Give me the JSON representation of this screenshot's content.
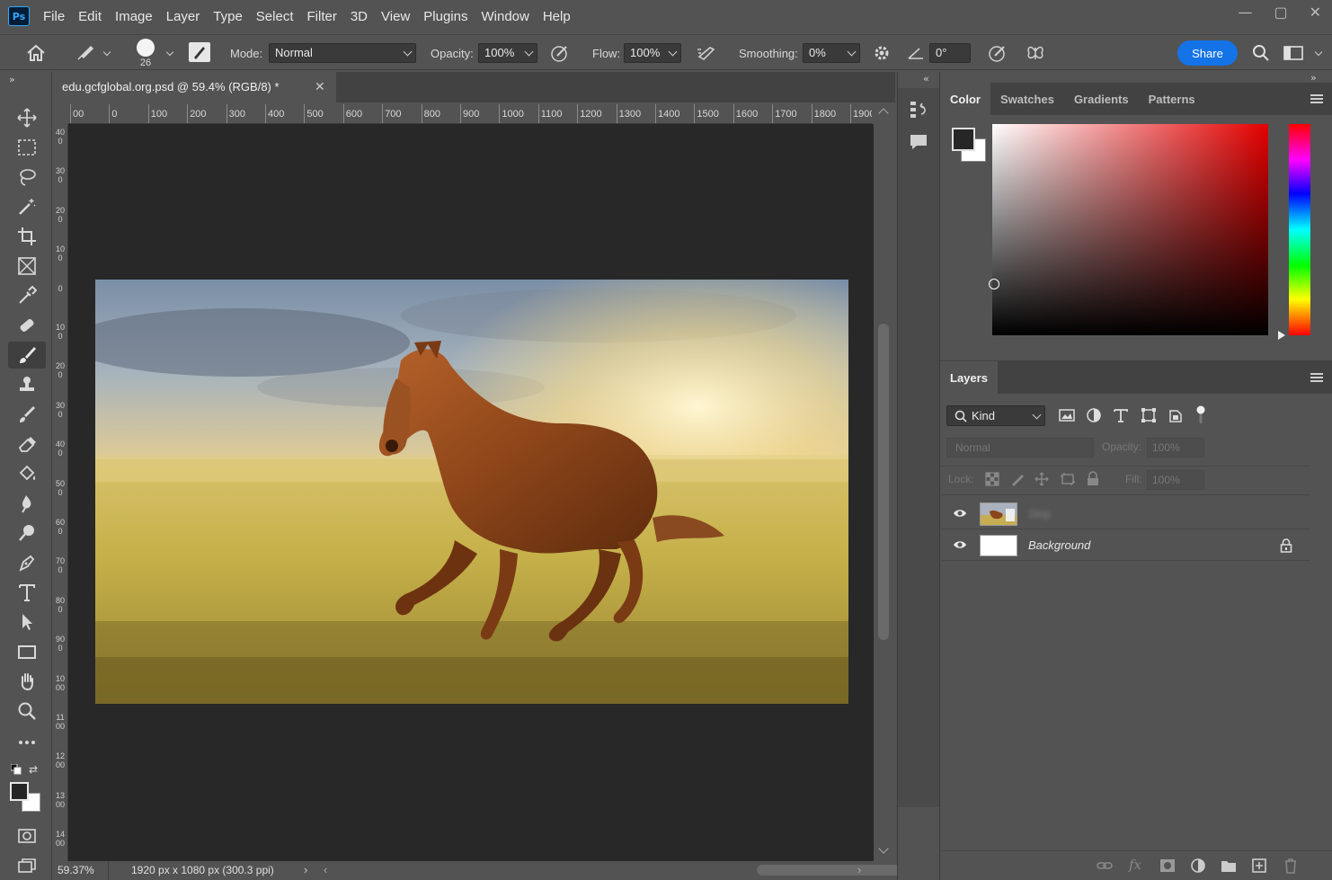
{
  "app": {
    "logo": "Ps"
  },
  "menu": [
    "File",
    "Edit",
    "Image",
    "Layer",
    "Type",
    "Select",
    "Filter",
    "3D",
    "View",
    "Plugins",
    "Window",
    "Help"
  ],
  "window_controls": {
    "minimize": "—",
    "maximize": "▢",
    "close": "✕"
  },
  "options": {
    "brush_size": "26",
    "mode_label": "Mode:",
    "mode_value": "Normal",
    "opacity_label": "Opacity:",
    "opacity_value": "100%",
    "flow_label": "Flow:",
    "flow_value": "100%",
    "smoothing_label": "Smoothing:",
    "smoothing_value": "0%",
    "angle_value": "0°",
    "share_label": "Share"
  },
  "document": {
    "tab_title": "edu.gcfglobal.org.psd @ 59.4% (RGB/8) *",
    "zoom": "59.37%",
    "dimensions": "1920 px x 1080 px (300.3 ppi)"
  },
  "ruler": {
    "top_ticks": [
      "00",
      "0",
      "100",
      "200",
      "300",
      "400",
      "500",
      "600",
      "700",
      "800",
      "900",
      "1000",
      "1100",
      "1200",
      "1300",
      "1400",
      "1500",
      "1600",
      "1700",
      "1800",
      "1900"
    ],
    "left_ticks": [
      "400",
      "300",
      "200",
      "100",
      "0",
      "100",
      "200",
      "300",
      "400",
      "500",
      "600",
      "700",
      "800",
      "900",
      "1000",
      "1100",
      "1200",
      "1300",
      "1400"
    ]
  },
  "color_panel": {
    "tabs": [
      "Color",
      "Swatches",
      "Gradients",
      "Patterns"
    ],
    "active_tab": "Color",
    "foreground": "#262626",
    "background": "#ffffff"
  },
  "layers_panel": {
    "title": "Layers",
    "filter_kind": "Kind",
    "blend_mode": "Normal",
    "opacity_label": "Opacity:",
    "opacity_value": "100%",
    "lock_label": "Lock:",
    "fill_label": "Fill:",
    "fill_value": "100%",
    "layers": [
      {
        "name": "Skip",
        "visible": true,
        "locked": false
      },
      {
        "name": "Background",
        "visible": true,
        "locked": true
      }
    ]
  }
}
